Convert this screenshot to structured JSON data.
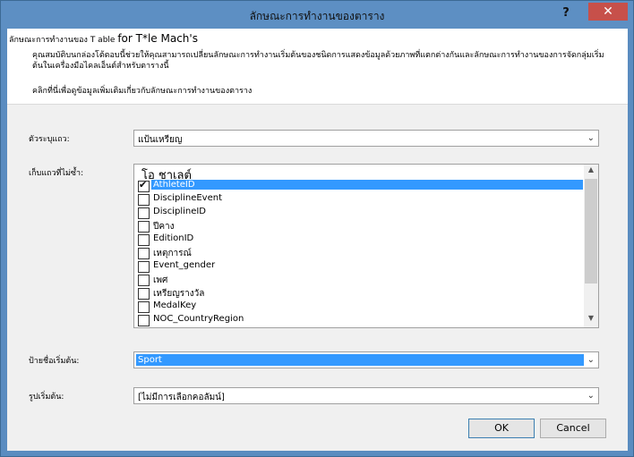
{
  "window": {
    "title": "ลักษณะการทำงานของตาราง",
    "help_label": "?",
    "close_label": "✕"
  },
  "header": {
    "title_prefix": "ลักษณะการทำงานของ T able",
    "title_big": "for T*le Mach's",
    "description": "คุณสมบัติบนกล่องโต้ตอบนี้ช่วยให้คุณสามารถเปลี่ยนลักษณะการทำงานเริ่มต้นของชนิดการแสดงข้อมูลด้วยภาพที่แตกต่างกันและลักษณะการทำงานของการจัดกลุ่มเริ่มต้นในเครื่องมือไคลเอ็นต์สำหรับตารางนี้",
    "link_text": "คลิกที่นี่เพื่อดูข้อมูลเพิ่มเติมเกี่ยวกับลักษณะการทำงานของตาราง"
  },
  "row_identifier": {
    "label": "ตัวระบุแถว:",
    "value": "แป้นเหรียญ"
  },
  "keep_unique_rows": {
    "label": "เก็บแถวที่ไม่ซ้ำ:",
    "list_header": "โอ ชาเลต์",
    "items": [
      {
        "label": "AthleteID",
        "checked": true,
        "selected": true
      },
      {
        "label": "DisciplineEvent",
        "checked": false,
        "selected": false
      },
      {
        "label": "DisciplineID",
        "checked": false,
        "selected": false
      },
      {
        "label": "ปีคาง",
        "checked": false,
        "selected": false
      },
      {
        "label": "EditionID",
        "checked": false,
        "selected": false
      },
      {
        "label": "เหตุการณ์",
        "checked": false,
        "selected": false
      },
      {
        "label": "Event_gender",
        "checked": false,
        "selected": false
      },
      {
        "label": "เพศ",
        "checked": false,
        "selected": false
      },
      {
        "label": "เหรียญรางวัล",
        "checked": false,
        "selected": false
      },
      {
        "label": "MedalKey",
        "checked": false,
        "selected": false
      },
      {
        "label": "NOC_CountryRegion",
        "checked": false,
        "selected": false
      }
    ]
  },
  "default_label": {
    "label": "ป้ายชื่อเริ่มต้น:",
    "value": "Sport"
  },
  "default_image": {
    "label": "รูปเริ่มต้น:",
    "value": "[ไม่มีการเลือกคอลัมน์]"
  },
  "buttons": {
    "ok": "OK",
    "cancel": "Cancel"
  },
  "icons": {
    "dropdown": "chevron-down-icon",
    "scroll_up": "▲",
    "scroll_down": "▼"
  }
}
